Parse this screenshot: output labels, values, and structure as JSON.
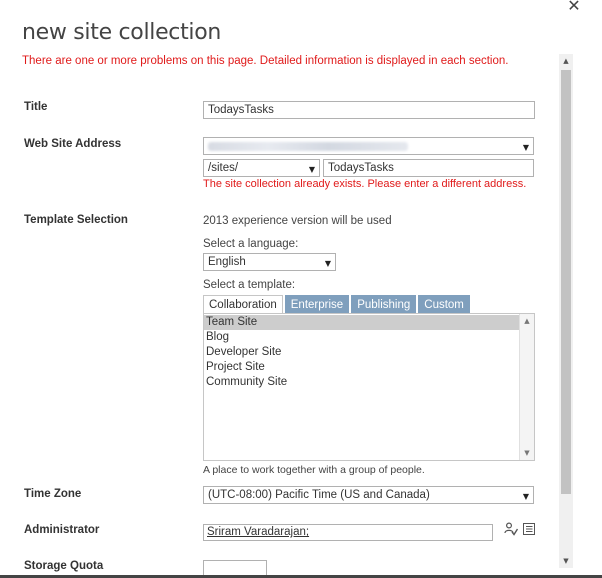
{
  "dialog": {
    "close_glyph": "✕"
  },
  "page": {
    "title": "new site collection",
    "error_summary": "There are one or more problems on this page. Detailed information is displayed in each section."
  },
  "title_field": {
    "label": "Title",
    "value": "TodaysTasks"
  },
  "web_address": {
    "label": "Web Site Address",
    "host_value_blurred": true,
    "path_select": "/sites/",
    "url_value": "TodaysTasks",
    "error": "The site collection already exists. Please enter a different address."
  },
  "template": {
    "label": "Template Selection",
    "experience_note": "2013 experience version will be used",
    "language_label": "Select a language:",
    "language_value": "English",
    "template_label": "Select a template:",
    "tabs": [
      {
        "label": "Collaboration",
        "active": true
      },
      {
        "label": "Enterprise",
        "active": false
      },
      {
        "label": "Publishing",
        "active": false
      },
      {
        "label": "Custom",
        "active": false
      }
    ],
    "items": [
      "Team Site",
      "Blog",
      "Developer Site",
      "Project Site",
      "Community Site"
    ],
    "selected_item": "Team Site",
    "description": "A place to work together with a group of people."
  },
  "time_zone": {
    "label": "Time Zone",
    "value": "(UTC-08:00) Pacific Time (US and Canada)"
  },
  "administrator": {
    "label": "Administrator",
    "value": "Sriram Varadarajan;",
    "check_names_icon": "check-names-icon",
    "browse_icon": "address-book-icon"
  },
  "storage_quota": {
    "label": "Storage Quota"
  },
  "colors": {
    "error": "#e01a1a",
    "tab_inactive": "#7f9fbd",
    "selected_item": "#cdcdcd"
  }
}
